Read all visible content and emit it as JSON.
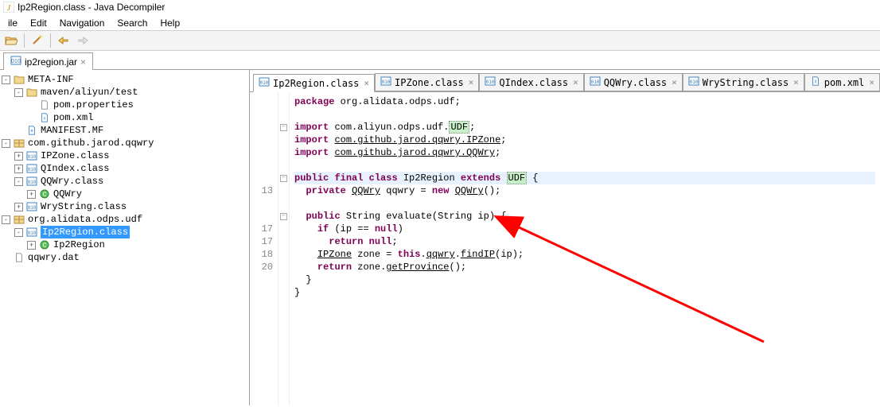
{
  "window": {
    "title": "Ip2Region.class - Java Decompiler"
  },
  "menu": {
    "file": "ile",
    "edit": "Edit",
    "navigation": "Navigation",
    "search": "Search",
    "help": "Help"
  },
  "outer_tab": {
    "label": "ip2region.jar",
    "close": "×"
  },
  "tree": {
    "items": [
      {
        "depth": 0,
        "exp": "-",
        "icon": "folder",
        "label": "META-INF"
      },
      {
        "depth": 1,
        "exp": "-",
        "icon": "folder",
        "label": "maven/aliyun/test"
      },
      {
        "depth": 2,
        "exp": "",
        "icon": "file",
        "label": "pom.properties"
      },
      {
        "depth": 2,
        "exp": "",
        "icon": "xml",
        "label": "pom.xml"
      },
      {
        "depth": 1,
        "exp": "",
        "icon": "mf",
        "label": "MANIFEST.MF"
      },
      {
        "depth": 0,
        "exp": "-",
        "icon": "pkg",
        "label": "com.github.jarod.qqwry"
      },
      {
        "depth": 1,
        "exp": "+",
        "icon": "class",
        "label": "IPZone.class"
      },
      {
        "depth": 1,
        "exp": "+",
        "icon": "class",
        "label": "QIndex.class"
      },
      {
        "depth": 1,
        "exp": "-",
        "icon": "class",
        "label": "QQWry.class"
      },
      {
        "depth": 2,
        "exp": "+",
        "icon": "cls-g",
        "label": "QQWry"
      },
      {
        "depth": 1,
        "exp": "+",
        "icon": "class",
        "label": "WryString.class"
      },
      {
        "depth": 0,
        "exp": "-",
        "icon": "pkg",
        "label": "org.alidata.odps.udf"
      },
      {
        "depth": 1,
        "exp": "-",
        "icon": "class",
        "label": "Ip2Region.class",
        "selected": true
      },
      {
        "depth": 2,
        "exp": "+",
        "icon": "cls-g",
        "label": "Ip2Region"
      },
      {
        "depth": 0,
        "exp": "",
        "icon": "file",
        "label": "qqwry.dat"
      }
    ]
  },
  "editor_tabs": [
    {
      "icon": "class",
      "label": "Ip2Region.class",
      "active": true
    },
    {
      "icon": "class",
      "label": "IPZone.class"
    },
    {
      "icon": "class",
      "label": "QIndex.class"
    },
    {
      "icon": "class",
      "label": "QQWry.class"
    },
    {
      "icon": "class",
      "label": "WryString.class"
    },
    {
      "icon": "xml",
      "label": "pom.xml"
    }
  ],
  "tab_close": "×",
  "code": {
    "lines": [
      {
        "ln": "",
        "fold": "",
        "frags": [
          {
            "cls": "kw",
            "t": "package"
          },
          {
            "t": " org.alidata.odps.udf;"
          }
        ]
      },
      {
        "ln": "",
        "fold": "",
        "frags": []
      },
      {
        "ln": "",
        "fold": "m",
        "frags": [
          {
            "cls": "kw",
            "t": "import"
          },
          {
            "t": " com.aliyun.odps.udf."
          },
          {
            "cls": "hl-udf",
            "t": "UDF"
          },
          {
            "t": ";"
          }
        ]
      },
      {
        "ln": "",
        "fold": "",
        "frags": [
          {
            "cls": "kw",
            "t": "import"
          },
          {
            "t": " "
          },
          {
            "cls": "underline",
            "t": "com.github.jarod.qqwry.IPZone"
          },
          {
            "t": ";"
          }
        ]
      },
      {
        "ln": "",
        "fold": "",
        "frags": [
          {
            "cls": "kw",
            "t": "import"
          },
          {
            "t": " "
          },
          {
            "cls": "underline",
            "t": "com.github.jarod.qqwry.QQWry"
          },
          {
            "t": ";"
          }
        ]
      },
      {
        "ln": "",
        "fold": "",
        "frags": []
      },
      {
        "ln": "",
        "fold": "m",
        "hl": true,
        "frags": [
          {
            "cls": "kw",
            "t": "public final class"
          },
          {
            "t": " Ip2Region "
          },
          {
            "cls": "kw",
            "t": "extends"
          },
          {
            "t": " "
          },
          {
            "cls": "hl-udf",
            "t": "UDF"
          },
          {
            "t": " {"
          }
        ]
      },
      {
        "ln": "13",
        "fold": "",
        "frags": [
          {
            "t": "  "
          },
          {
            "cls": "kw",
            "t": "private"
          },
          {
            "t": " "
          },
          {
            "cls": "underline",
            "t": "QQWry"
          },
          {
            "t": " qqwry = "
          },
          {
            "cls": "kw",
            "t": "new"
          },
          {
            "t": " "
          },
          {
            "cls": "underline",
            "t": "QQWry"
          },
          {
            "t": "();"
          }
        ]
      },
      {
        "ln": "",
        "fold": "",
        "frags": [
          {
            "t": "  "
          }
        ]
      },
      {
        "ln": "",
        "fold": "m",
        "frags": [
          {
            "t": "  "
          },
          {
            "cls": "kw",
            "t": "public"
          },
          {
            "t": " String evaluate(String ip) {"
          }
        ]
      },
      {
        "ln": "17",
        "fold": "",
        "frags": [
          {
            "t": "    "
          },
          {
            "cls": "kw",
            "t": "if"
          },
          {
            "t": " (ip == "
          },
          {
            "cls": "kw",
            "t": "null"
          },
          {
            "t": ")"
          }
        ]
      },
      {
        "ln": "17",
        "fold": "",
        "frags": [
          {
            "t": "      "
          },
          {
            "cls": "kw",
            "t": "return"
          },
          {
            "t": " "
          },
          {
            "cls": "kw",
            "t": "null"
          },
          {
            "t": ";"
          }
        ]
      },
      {
        "ln": "18",
        "fold": "",
        "frags": [
          {
            "t": "    "
          },
          {
            "cls": "underline",
            "t": "IPZone"
          },
          {
            "t": " zone = "
          },
          {
            "cls": "kw",
            "t": "this"
          },
          {
            "t": "."
          },
          {
            "cls": "underline",
            "t": "qqwry"
          },
          {
            "t": "."
          },
          {
            "cls": "underline",
            "t": "findIP"
          },
          {
            "t": "(ip);"
          }
        ]
      },
      {
        "ln": "20",
        "fold": "",
        "frags": [
          {
            "t": "    "
          },
          {
            "cls": "kw",
            "t": "return"
          },
          {
            "t": " zone."
          },
          {
            "cls": "underline",
            "t": "getProvince"
          },
          {
            "t": "();"
          }
        ]
      },
      {
        "ln": "",
        "fold": "",
        "frags": [
          {
            "t": "  }"
          }
        ]
      },
      {
        "ln": "",
        "fold": "",
        "frags": [
          {
            "t": "}"
          }
        ]
      }
    ]
  }
}
